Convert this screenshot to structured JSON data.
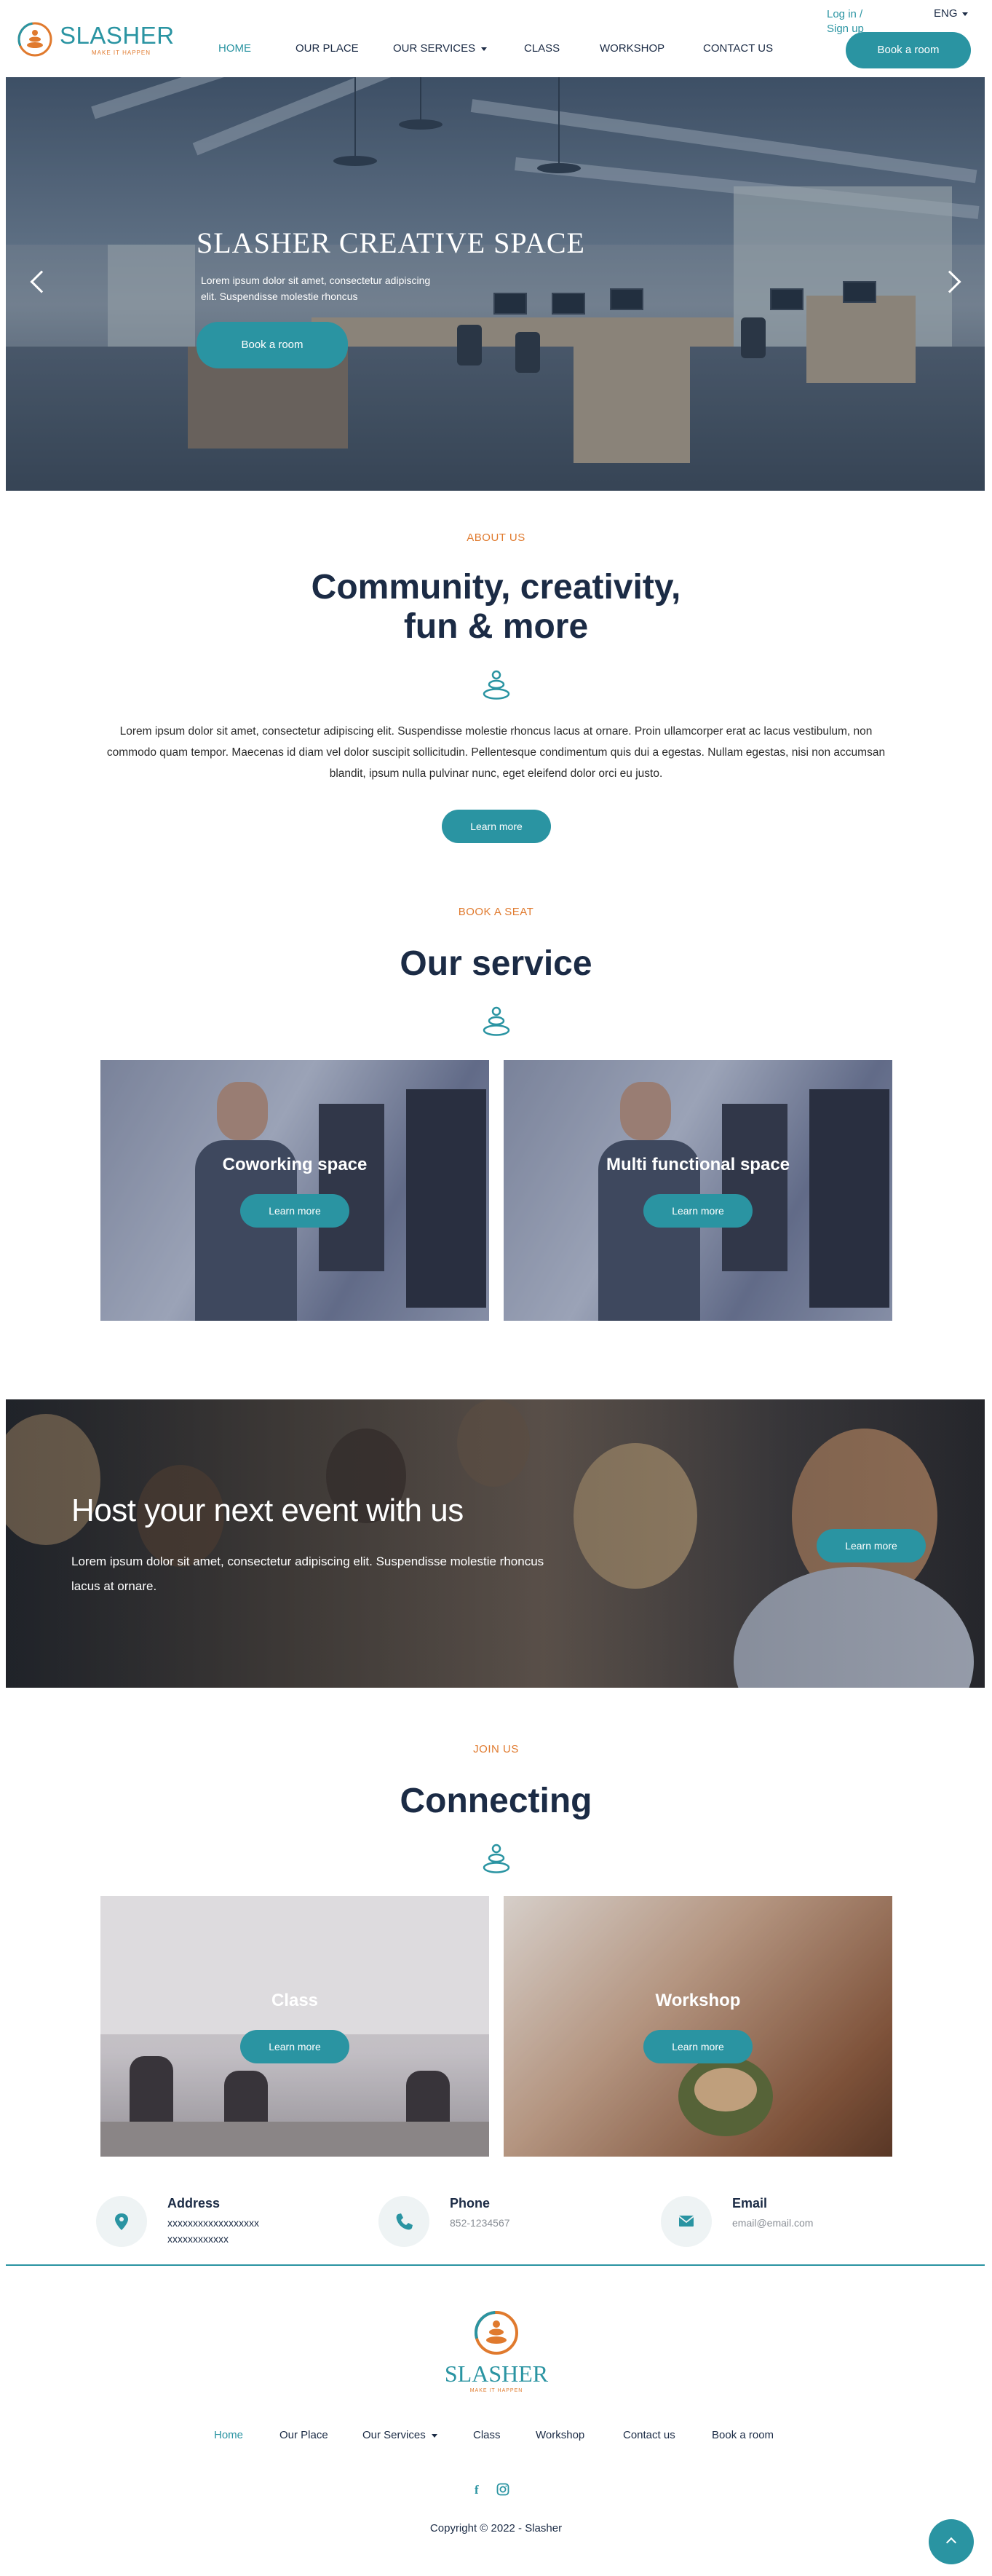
{
  "header": {
    "logo_text": "SLASHER",
    "logo_tagline": "make it happen",
    "nav": [
      {
        "label": "HOME"
      },
      {
        "label": "OUR PLACE"
      },
      {
        "label": "OUR SERVICES"
      },
      {
        "label": "CLASS"
      },
      {
        "label": "WORKSHOP"
      },
      {
        "label": "CONTACT US"
      }
    ],
    "login": "Log in /",
    "signup": "Sign up",
    "language": "ENG",
    "book_button": "Book a room"
  },
  "hero": {
    "title": "SLASHER CREATIVE SPACE",
    "text": "Lorem ipsum dolor sit amet, consectetur adipiscing elit. Suspendisse molestie rhoncus",
    "button": "Book a room"
  },
  "about": {
    "eyebrow": "ABOUT US",
    "title_line1": "Community, creativity,",
    "title_line2": "fun & more",
    "text": "Lorem ipsum dolor sit amet, consectetur adipiscing elit. Suspendisse molestie rhoncus lacus at ornare. Proin ullamcorper erat ac lacus vestibulum, non commodo quam tempor. Maecenas id diam vel dolor suscipit sollicitudin. Pellentesque condimentum quis dui a egestas. Nullam egestas, nisi non accumsan blandit, ipsum nulla pulvinar nunc, eget eleifend dolor orci eu justo.",
    "button": "Learn more"
  },
  "services": {
    "eyebrow": "BOOK A SEAT",
    "title": "Our service",
    "cards": [
      {
        "title": "Coworking space",
        "button": "Learn more"
      },
      {
        "title": "Multi functional space",
        "button": "Learn more"
      }
    ]
  },
  "event": {
    "title": "Host your next event with us",
    "text": "Lorem ipsum dolor sit amet, consectetur adipiscing elit. Suspendisse molestie rhoncus lacus at ornare.",
    "button": "Learn more"
  },
  "connecting": {
    "eyebrow": "JOIN US",
    "title": "Connecting",
    "cards": [
      {
        "title": "Class",
        "button": "Learn more"
      },
      {
        "title": "Workshop",
        "button": "Learn more"
      }
    ]
  },
  "contact": {
    "address_label": "Address",
    "address_line1": "xxxxxxxxxxxxxxxxxx",
    "address_line2": "xxxxxxxxxxxx",
    "phone_label": "Phone",
    "phone_value": "852-1234567",
    "email_label": "Email",
    "email_value": "email@email.com"
  },
  "footer": {
    "logo_text": "SLASHER",
    "logo_tagline": "make it happen",
    "nav": [
      {
        "label": "Home"
      },
      {
        "label": "Our Place"
      },
      {
        "label": "Our Services"
      },
      {
        "label": "Class"
      },
      {
        "label": "Workshop"
      },
      {
        "label": "Contact us"
      },
      {
        "label": "Book a room"
      }
    ],
    "social_facebook": "f",
    "copyright": "Copyright © 2022 - Slasher"
  },
  "colors": {
    "accent": "#2a94a2",
    "eyebrow": "#e07a2e",
    "heading": "#1b2b45"
  },
  "icons": [
    "logo-mark-icon",
    "chevron-down-icon",
    "arrow-left-icon",
    "arrow-right-icon",
    "zen-stones-icon",
    "map-pin-icon",
    "phone-icon",
    "envelope-icon",
    "facebook-icon",
    "instagram-icon",
    "arrow-up-icon"
  ]
}
